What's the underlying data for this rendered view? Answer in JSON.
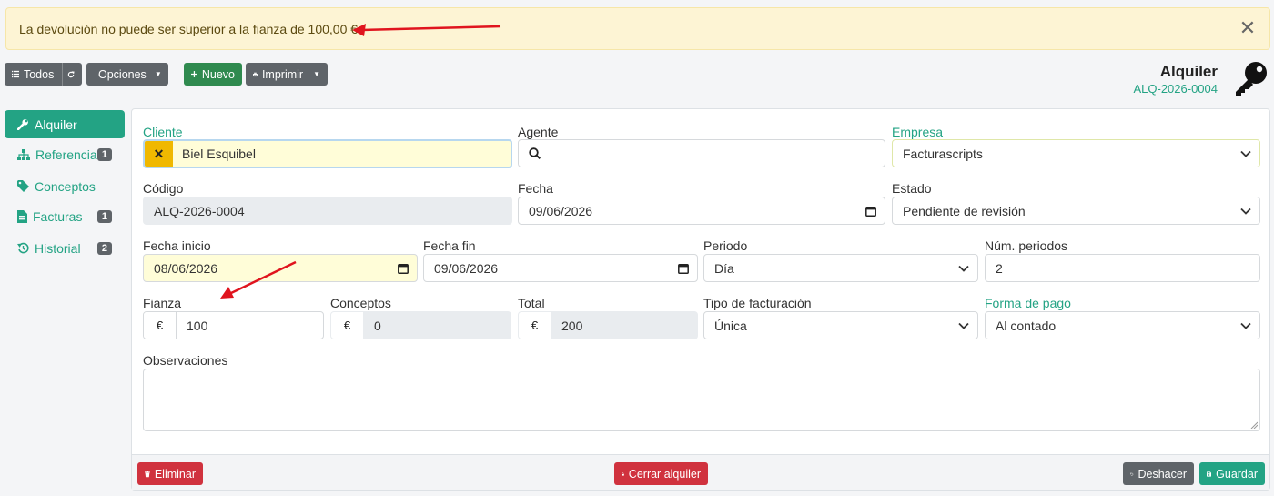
{
  "alert": {
    "message": "La devolución no puede ser superior a la fianza de 100,00 €."
  },
  "toolbar": {
    "todos_label": "Todos",
    "opciones_label": "Opciones",
    "nuevo_label": "Nuevo",
    "imprimir_label": "Imprimir"
  },
  "header": {
    "title": "Alquiler",
    "code": "ALQ-2026-0004"
  },
  "sidebar": {
    "items": [
      {
        "label": "Alquiler"
      },
      {
        "label": "Referencias",
        "badge": "1"
      },
      {
        "label": "Conceptos"
      },
      {
        "label": "Facturas",
        "badge": "1"
      },
      {
        "label": "Historial",
        "badge": "2"
      }
    ]
  },
  "form": {
    "cliente": {
      "label": "Cliente",
      "value": "Biel Esquibel"
    },
    "agente": {
      "label": "Agente",
      "value": ""
    },
    "empresa": {
      "label": "Empresa",
      "value": "Facturascripts"
    },
    "codigo": {
      "label": "Código",
      "value": "ALQ-2026-0004"
    },
    "fecha": {
      "label": "Fecha",
      "value": "09/06/2026"
    },
    "estado": {
      "label": "Estado",
      "value": "Pendiente de revisión"
    },
    "fecha_inicio": {
      "label": "Fecha inicio",
      "value": "08/06/2026"
    },
    "fecha_fin": {
      "label": "Fecha fin",
      "value": "09/06/2026"
    },
    "periodo": {
      "label": "Periodo",
      "value": "Día"
    },
    "num_periodos": {
      "label": "Núm. periodos",
      "value": "2"
    },
    "fianza": {
      "label": "Fianza",
      "value": "100",
      "currency": "€"
    },
    "conceptos": {
      "label": "Conceptos",
      "value": "0",
      "currency": "€"
    },
    "total": {
      "label": "Total",
      "value": "200",
      "currency": "€"
    },
    "tipo_facturacion": {
      "label": "Tipo de facturación",
      "value": "Única"
    },
    "forma_pago": {
      "label": "Forma de pago",
      "value": "Al contado"
    },
    "observaciones": {
      "label": "Observaciones",
      "value": ""
    }
  },
  "footer": {
    "eliminar_label": "Eliminar",
    "cerrar_label": "Cerrar alquiler",
    "deshacer_label": "Deshacer",
    "guardar_label": "Guardar"
  },
  "colors": {
    "accent": "#23a384",
    "alert_bg": "#fdf4d4",
    "danger": "#d0323e",
    "success": "#2f8a4f",
    "secondary": "#5f6469",
    "annotation": "#e0141e"
  },
  "icons": [
    "list-icon",
    "refresh-icon",
    "wrench-icon",
    "plus-icon",
    "printer-icon",
    "key-icon",
    "tag-icon",
    "sitemap-icon",
    "file-invoice-icon",
    "history-icon",
    "search-icon",
    "times-icon",
    "calendar-icon",
    "chevron-down-icon",
    "trash-icon",
    "lock-icon",
    "undo-icon",
    "save-icon",
    "close-icon"
  ]
}
